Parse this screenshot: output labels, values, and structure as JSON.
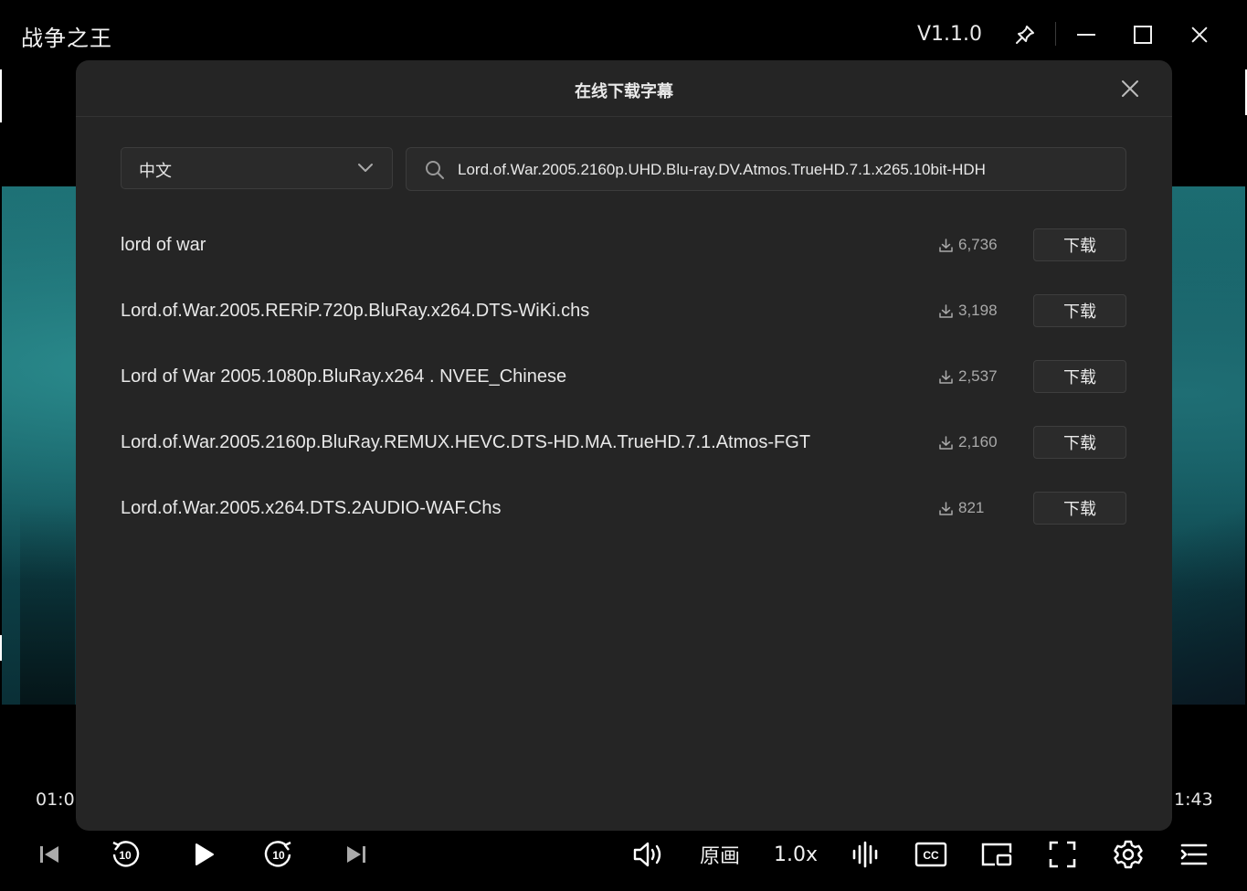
{
  "window": {
    "title": "战争之王",
    "version": "V1.1.0"
  },
  "icons": {
    "pin": "pin-icon",
    "minimize": "minimize-icon",
    "maximize": "maximize-icon",
    "close": "close-icon"
  },
  "dialog": {
    "title": "在线下载字幕",
    "language": "中文",
    "search_value": "Lord.of.War.2005.2160p.UHD.Blu-ray.DV.Atmos.TrueHD.7.1.x265.10bit-HDH",
    "download_label": "下载",
    "results": [
      {
        "name": "lord of war",
        "downloads": "6,736"
      },
      {
        "name": "Lord.of.War.2005.RERiP.720p.BluRay.x264.DTS-WiKi.chs",
        "downloads": "3,198"
      },
      {
        "name": "Lord of War 2005.1080p.BluRay.x264 . NVEE_Chinese",
        "downloads": "2,537"
      },
      {
        "name": "Lord.of.War.2005.2160p.BluRay.REMUX.HEVC.DTS-HD.MA.TrueHD.7.1.Atmos-FGT",
        "downloads": "2,160"
      },
      {
        "name": "Lord.of.War.2005.x264.DTS.2AUDIO-WAF.Chs",
        "downloads": "821"
      }
    ]
  },
  "player": {
    "time_current": "01:0",
    "time_total": "1:43",
    "original_quality": "原画",
    "speed": "1.0x",
    "skip_back_seconds": "10",
    "skip_forward_seconds": "10"
  }
}
